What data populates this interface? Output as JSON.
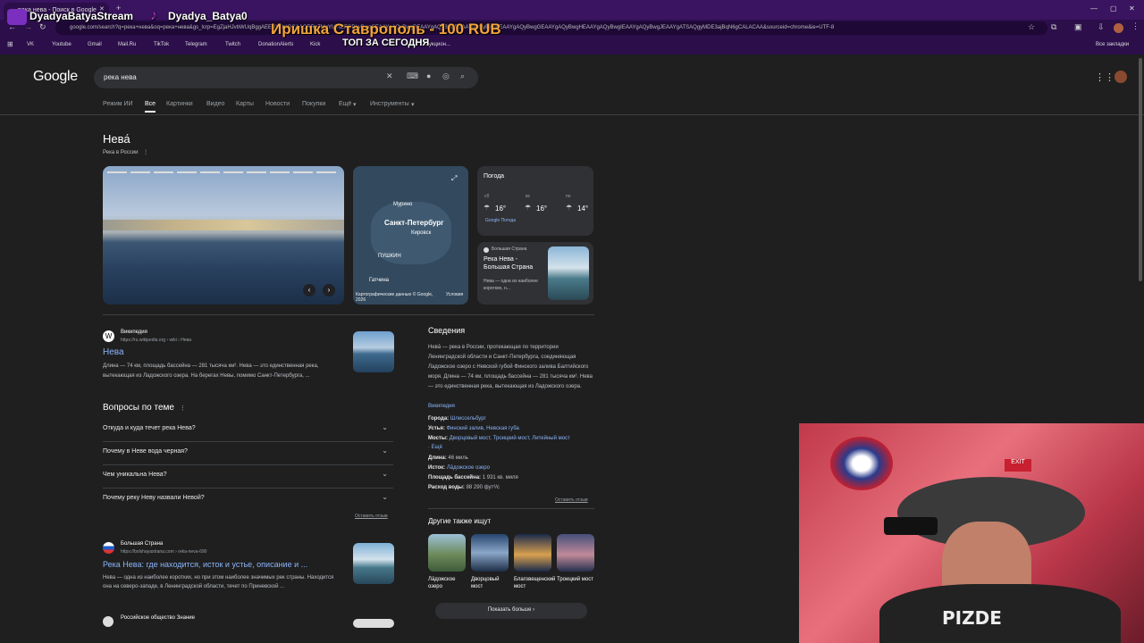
{
  "browser": {
    "tab_title": "река нева - Поиск в Google",
    "url": "google.com/search?q=река+нева&oq=река+нева&gs_lcrp=EgZjaHJvbWUqBggAEEUYOzIGCAAQRRg7MgYIARBFGDkyBwgCEAAYgAQyBwgDEAAYgAQyBwgEEAAYgAQyBwgFEAAYgAQyBwgGEAAYgAQyBwgHEAAYgAQyBwgIEAAYgAQyBwgJEAAYgATSAQgyMDE3ajBqN6gCALACAA&sourceid=chrome&ie=UTF-8",
    "bookmarks": [
      "VK",
      "Youtube",
      "Gmail",
      "Mail.Ru",
      "TikTok",
      "Telegram",
      "Twitch",
      "DonationAlerts",
      "Kick",
      "Аукцион..."
    ],
    "all_bookmarks": "Все закладки"
  },
  "overlay": {
    "stream_name": "DyadyaBatyaStream",
    "tiktok_name": "Dyadya_Batya0",
    "donation": "Иришка Ставрополь - 100 RUB",
    "top_today": "ТОП ЗА СЕГОДНЯ"
  },
  "search": {
    "logo": "Google",
    "query": "река нева",
    "tabs": [
      "Режим ИИ",
      "Все",
      "Картинки",
      "Видео",
      "Карты",
      "Новости",
      "Покупки",
      "Ещё",
      "Инструменты"
    ]
  },
  "entity": {
    "title": "Нева́",
    "subtitle": "Река в России",
    "map_city": "Санкт-Петербург",
    "map_places": [
      "Мурино",
      "Кировск",
      "ПУШКИН",
      "Гатчина"
    ],
    "map_credit": "Картографические данные © Google, 2026",
    "map_terms": "Условия"
  },
  "weather": {
    "title": "Погода",
    "days": [
      {
        "day": "сб",
        "temp": "16°"
      },
      {
        "day": "вс",
        "temp": "16°"
      },
      {
        "day": "пн",
        "temp": "14°"
      }
    ],
    "source": "Google Погода"
  },
  "article_card": {
    "site": "Большая Страна",
    "title": "Река Нева - Большая Страна",
    "snippet": "Нева — одна из наиболее коротких, н..."
  },
  "wiki_result": {
    "site": "Википедия",
    "url": "https://ru.wikipedia.org › wiki › Нева",
    "title": "Нева",
    "snippet": "Длина — 74 км, площадь бассейна — 281 тысяча км². Нева — это единственная река, вытекающая из Ладожского озера. На берегах Невы, помимо Санкт-Петербурга, ..."
  },
  "paa": {
    "title": "Вопросы по теме",
    "questions": [
      "Откуда и куда течет река Нева?",
      "Почему в Неве вода черная?",
      "Чем уникальна Нева?",
      "Почему реку Неву назвали Невой?"
    ],
    "feedback": "Оставить отзыв"
  },
  "bs_result": {
    "site": "Большая Страна",
    "url": "https://bolshayastrana.com › reka-neva-690",
    "title": "Река Нева: где находится, исток и устье, описание и ...",
    "snippet": "Нева — одна из наиболее коротких, но при этом наиболее значимых рек страны. Находится она на северо-западе, в Ленинградской области, течет по Приневской ..."
  },
  "next_result_site": "Российское общество Знание",
  "info": {
    "title": "Сведения",
    "text": "Нева́ — река в России, протекающая по территории Ленинградской области и Санкт-Петербурга, соединяющая Ладожское озеро с Невской губой Финского залива Балтийского моря. Длина — 74 км, площадь бассейна — 281 тысяча км². Нева — это единственная река, вытекающая из Ладожского озера.",
    "source": "Википедия",
    "facts": [
      {
        "k": "Города:",
        "v": "Шлиссельбург"
      },
      {
        "k": "Устья:",
        "v": "Финский залив, Невская губа"
      },
      {
        "k": "Мосты:",
        "v": "Дворцовый мост, Троицкий мост, Литейный мост"
      },
      {
        "k": "",
        "v": "· Ещё"
      },
      {
        "k": "Длина:",
        "v": "46 миль"
      },
      {
        "k": "Исток:",
        "v": "Ла́дожское озеро"
      },
      {
        "k": "Площадь бассейна:",
        "v": "1 931 кв. миля"
      },
      {
        "k": "Расход воды:",
        "v": "88 290 фут³/с"
      }
    ],
    "feedback": "Оставить отзыв"
  },
  "also_search": {
    "title": "Другие также ищут",
    "items": [
      "Ла́дожское озеро",
      "Дворцовый мост",
      "Благовещенский мост",
      "Троицкий мост"
    ],
    "more": "Показать больше"
  },
  "webcam": {
    "shirt_text": "PIZDE"
  }
}
